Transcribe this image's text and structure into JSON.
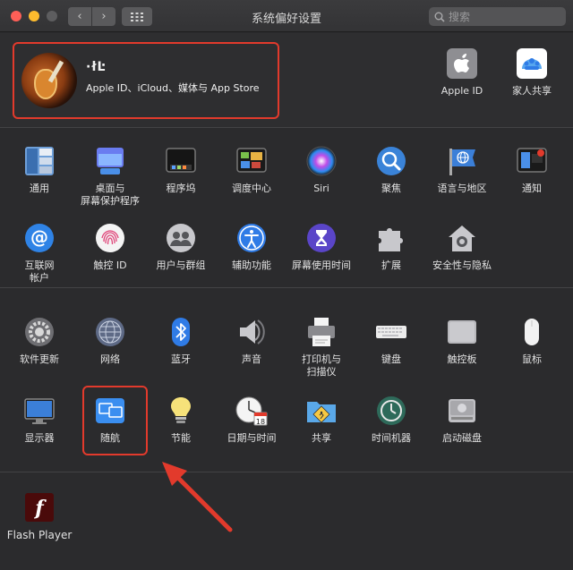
{
  "window": {
    "title": "系统偏好设置",
    "search_placeholder": "搜索"
  },
  "account": {
    "username": "·łĿ",
    "subtitle": "Apple ID、iCloud、媒体与 App Store",
    "apple_id_label": "Apple ID",
    "family_label": "家人共享"
  },
  "row1": [
    "通用",
    "桌面与\n屏幕保护程序",
    "程序坞",
    "调度中心",
    "Siri",
    "聚焦",
    "语言与地区",
    "通知"
  ],
  "row2": [
    "互联网\n帐户",
    "触控 ID",
    "用户与群组",
    "辅助功能",
    "屏幕使用时间",
    "扩展",
    "安全性与隐私"
  ],
  "row3": [
    "软件更新",
    "网络",
    "蓝牙",
    "声音",
    "打印机与\n扫描仪",
    "键盘",
    "触控板",
    "鼠标"
  ],
  "row4": [
    "显示器",
    "随航",
    "节能",
    "日期与时间",
    "共享",
    "时间机器",
    "启动磁盘"
  ],
  "other": [
    "Flash Player"
  ],
  "calendar_day": "18",
  "colors": {
    "highlight": "#e23a2c",
    "accent": "#2f7be6"
  }
}
